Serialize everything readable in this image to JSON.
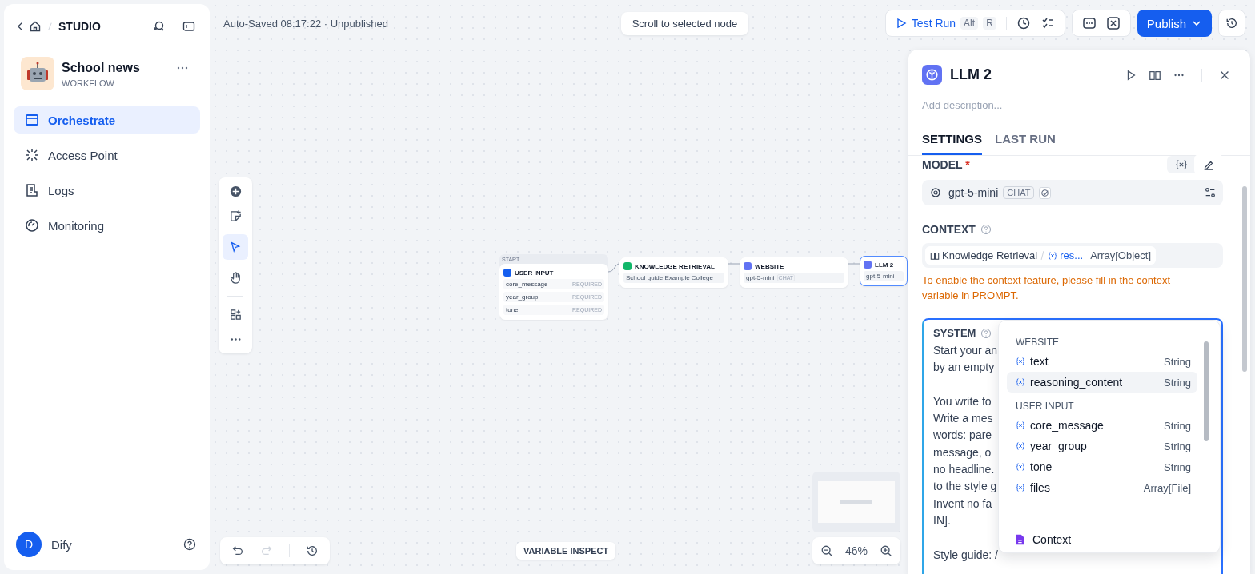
{
  "sidebar": {
    "breadcrumb": "STUDIO",
    "app": {
      "name": "School news",
      "type": "WORKFLOW"
    },
    "nav": [
      {
        "label": "Orchestrate",
        "kind": "orchestrate",
        "selected": true
      },
      {
        "label": "Access Point",
        "kind": "access",
        "selected": false
      },
      {
        "label": "Logs",
        "kind": "logs",
        "selected": false
      },
      {
        "label": "Monitoring",
        "kind": "monitoring",
        "selected": false
      }
    ],
    "user": {
      "initial": "D",
      "name": "Dify"
    }
  },
  "toolbar": {
    "status": "Auto-Saved 08:17:22 · Unpublished",
    "scroll_button": "Scroll to selected node",
    "test_run": {
      "label": "Test Run",
      "keys": [
        "Alt",
        "R"
      ]
    },
    "publish": "Publish"
  },
  "canvas": {
    "nodes": [
      {
        "kind": "start",
        "tag": "START",
        "title": "USER INPUT",
        "selected": false,
        "rows": [
          {
            "name": "core_message",
            "badge": "REQUIRED"
          },
          {
            "name": "year_group",
            "badge": "REQUIRED"
          },
          {
            "name": "tone",
            "badge": "REQUIRED"
          }
        ]
      },
      {
        "kind": "knowledge",
        "title": "KNOWLEDGE RETRIEVAL",
        "selected": false,
        "dataset": "School guide Example College"
      },
      {
        "kind": "llm",
        "title": "WEBSITE",
        "selected": false,
        "model": "gpt-5-mini",
        "mode": "CHAT"
      },
      {
        "kind": "llm",
        "title": "LLM 2",
        "selected": true,
        "model": "gpt-5-mini"
      }
    ],
    "variable_inspect": "VARIABLE INSPECT",
    "zoom": "46%"
  },
  "panel": {
    "title": "LLM 2",
    "description_placeholder": "Add description...",
    "tabs": [
      {
        "label": "SETTINGS",
        "selected": true
      },
      {
        "label": "LAST RUN",
        "selected": false
      }
    ],
    "model": {
      "label": "MODEL",
      "required_mark": "*",
      "name": "gpt-5-mini",
      "mode": "CHAT"
    },
    "context": {
      "label": "CONTEXT",
      "source": "Knowledge Retrieval",
      "variable": "res...",
      "type": "Array[Object]",
      "warning": "To enable the context feature, please fill in the context variable in PROMPT."
    },
    "system": {
      "label": "SYSTEM",
      "paragraphs": [
        [
          "Start your an",
          "by an empty"
        ],
        [
          "You write fo",
          "Write a mes",
          "words: pare",
          "message, o",
          "no headline.",
          "to the style g",
          "Invent no fa",
          "IN]."
        ],
        [
          "Style guide: /"
        ]
      ]
    },
    "variable_menu": {
      "groups": [
        {
          "title": "WEBSITE",
          "items": [
            {
              "name": "text",
              "type": "String",
              "selected": false
            },
            {
              "name": "reasoning_content",
              "type": "String",
              "selected": true
            }
          ]
        },
        {
          "title": "USER INPUT",
          "items": [
            {
              "name": "core_message",
              "type": "String",
              "selected": false
            },
            {
              "name": "year_group",
              "type": "String",
              "selected": false
            },
            {
              "name": "tone",
              "type": "String",
              "selected": false
            },
            {
              "name": "files",
              "type": "Array[File]",
              "selected": false
            }
          ]
        }
      ],
      "context_option": "Context"
    }
  }
}
